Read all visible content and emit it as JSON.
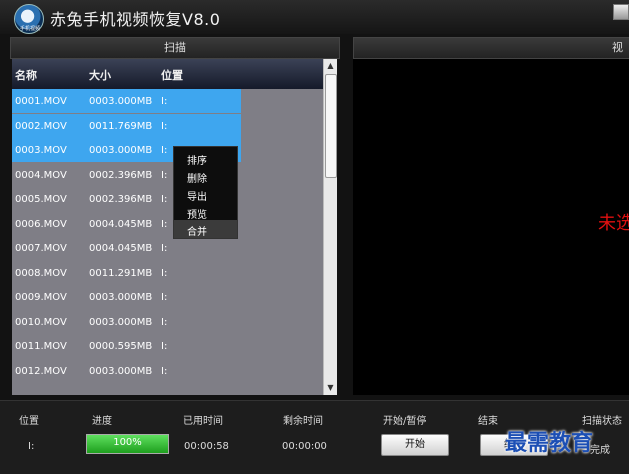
{
  "app": {
    "title": "赤兔手机视频恢复V8.0",
    "logo_text": "手机视频"
  },
  "panels": {
    "scan_title": "扫描",
    "video_title": "视频",
    "video_status": "未选择"
  },
  "list": {
    "columns": [
      "名称",
      "大小",
      "位置"
    ],
    "rows": [
      {
        "name": "0001.MOV",
        "size": "0003.000MB",
        "pos": "I:",
        "selected": true
      },
      {
        "name": "0002.MOV",
        "size": "0011.769MB",
        "pos": "I:",
        "selected": true
      },
      {
        "name": "0003.MOV",
        "size": "0003.000MB",
        "pos": "I:",
        "selected": true
      },
      {
        "name": "0004.MOV",
        "size": "0002.396MB",
        "pos": "I:",
        "selected": false
      },
      {
        "name": "0005.MOV",
        "size": "0002.396MB",
        "pos": "I:",
        "selected": false
      },
      {
        "name": "0006.MOV",
        "size": "0004.045MB",
        "pos": "I:",
        "selected": false
      },
      {
        "name": "0007.MOV",
        "size": "0004.045MB",
        "pos": "I:",
        "selected": false
      },
      {
        "name": "0008.MOV",
        "size": "0011.291MB",
        "pos": "I:",
        "selected": false
      },
      {
        "name": "0009.MOV",
        "size": "0003.000MB",
        "pos": "I:",
        "selected": false
      },
      {
        "name": "0010.MOV",
        "size": "0003.000MB",
        "pos": "I:",
        "selected": false
      },
      {
        "name": "0011.MOV",
        "size": "0000.595MB",
        "pos": "I:",
        "selected": false
      },
      {
        "name": "0012.MOV",
        "size": "0003.000MB",
        "pos": "I:",
        "selected": false
      }
    ]
  },
  "context_menu": {
    "items": [
      "排序",
      "删除",
      "导出",
      "预览",
      "合并"
    ],
    "hovered_index": 4
  },
  "status": {
    "labels": {
      "position": "位置",
      "progress": "进度",
      "elapsed": "已用时间",
      "remaining": "剩余时间",
      "start_pause": "开始/暂停",
      "end": "结束",
      "scan_state": "扫描状态"
    },
    "position_value": "I:",
    "progress_percent": 100,
    "progress_text": "100%",
    "elapsed_value": "00:00:58",
    "remaining_value": "00:00:00",
    "start_button": "开始",
    "end_button": "结束",
    "scan_state_value": "完成"
  },
  "watermark": "最需教育",
  "colors": {
    "selection": "#3ea6ef",
    "list_bg": "#7f7e86",
    "progress": "#2bbf2b",
    "status_text": "#e01010"
  }
}
